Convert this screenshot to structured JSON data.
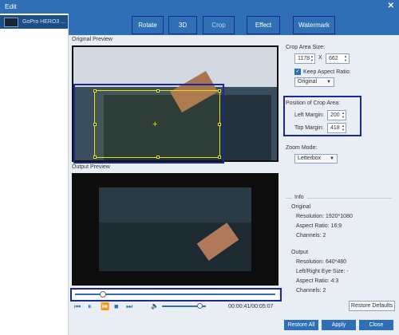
{
  "window": {
    "title": "Edit"
  },
  "file": {
    "name": "GoPro HERO3 ..."
  },
  "tabs": [
    {
      "label": "Rotate"
    },
    {
      "label": "3D"
    },
    {
      "label": "Crop"
    },
    {
      "label": "Effect"
    },
    {
      "label": "Watermark"
    }
  ],
  "preview": {
    "original_label": "Original Preview",
    "output_label": "Output Preview"
  },
  "player": {
    "time": "00:00:41/00:05:07",
    "progress": 0.14,
    "volume": 0.85
  },
  "crop": {
    "area_label": "Crop Area Size:",
    "width": "1178",
    "x": "X",
    "height": "662",
    "keep_aspect_label": "Keep Aspect Ratio:",
    "keep_aspect_checked": true,
    "aspect_value": "Original",
    "position_label": "Position of Crop Area:",
    "left_label": "Left Margin:",
    "left_value": "200",
    "top_label": "Top Margin:",
    "top_value": "418"
  },
  "zoom": {
    "label": "Zoom Mode:",
    "value": "Letterbox"
  },
  "info": {
    "header": "Info",
    "original_header": "Original",
    "original_resolution": "Resolution: 1920*1080",
    "original_aspect": "Aspect Ratio: 16:9",
    "original_channels": "Channels: 2",
    "output_header": "Output",
    "output_resolution": "Resolution: 640*480",
    "output_eye": "Left/Right Eye Size: -",
    "output_aspect": "Aspect Ratio: 4:3",
    "output_channels": "Channels: 2"
  },
  "buttons": {
    "restore_defaults": "Restore Defaults",
    "restore_all": "Restore All",
    "apply": "Apply",
    "close": "Close"
  },
  "icons": {
    "close": "✕",
    "prev": "⏮",
    "pause": "⏸",
    "forward": "⏩",
    "stop": "■",
    "next": "⏭",
    "volume": "🔈",
    "check": "✓",
    "crosshair": "+"
  },
  "colors": {
    "accent": "#2f6fb5",
    "highlight": "#1b2a8f",
    "crop": "#e6e600"
  }
}
